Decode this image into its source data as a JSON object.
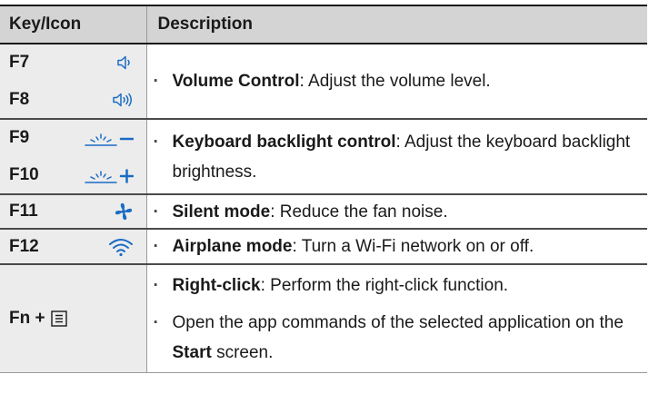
{
  "header": {
    "col_key": "Key/Icon",
    "col_desc": "Description"
  },
  "rows": {
    "volume": {
      "keys": [
        {
          "label": "F7",
          "icon": "speaker-low-icon"
        },
        {
          "label": "F8",
          "icon": "speaker-high-icon"
        }
      ],
      "bullets": [
        {
          "bold": "Volume Control",
          "rest": ": Adjust the volume level."
        }
      ]
    },
    "backlight": {
      "keys": [
        {
          "label": "F9",
          "icon": "backlight-down-icon"
        },
        {
          "label": "F10",
          "icon": "backlight-up-icon"
        }
      ],
      "bullets": [
        {
          "bold": "Keyboard backlight control",
          "rest": ": Adjust the keyboard backlight brightness."
        }
      ]
    },
    "silent": {
      "keys": [
        {
          "label": "F11",
          "icon": "fan-icon"
        }
      ],
      "bullets": [
        {
          "bold": "Silent mode",
          "rest": ": Reduce the fan noise."
        }
      ]
    },
    "airplane": {
      "keys": [
        {
          "label": "F12",
          "icon": "wifi-icon"
        }
      ],
      "bullets": [
        {
          "bold": "Airplane mode",
          "rest": ": Turn a Wi-Fi network on or off."
        }
      ]
    },
    "menu": {
      "keys": [
        {
          "label": "Fn +",
          "icon": "menu-key-icon"
        }
      ],
      "bullets": [
        {
          "bold": "Right-click",
          "rest": ": Perform the right-click function."
        },
        {
          "pre": "Open the app commands of the selected application on the ",
          "bold": "Start",
          "post": " screen."
        }
      ]
    }
  },
  "colors": {
    "accent": "#1a6bc4",
    "header_bg": "#d4d4d4",
    "key_bg": "#ececec"
  }
}
